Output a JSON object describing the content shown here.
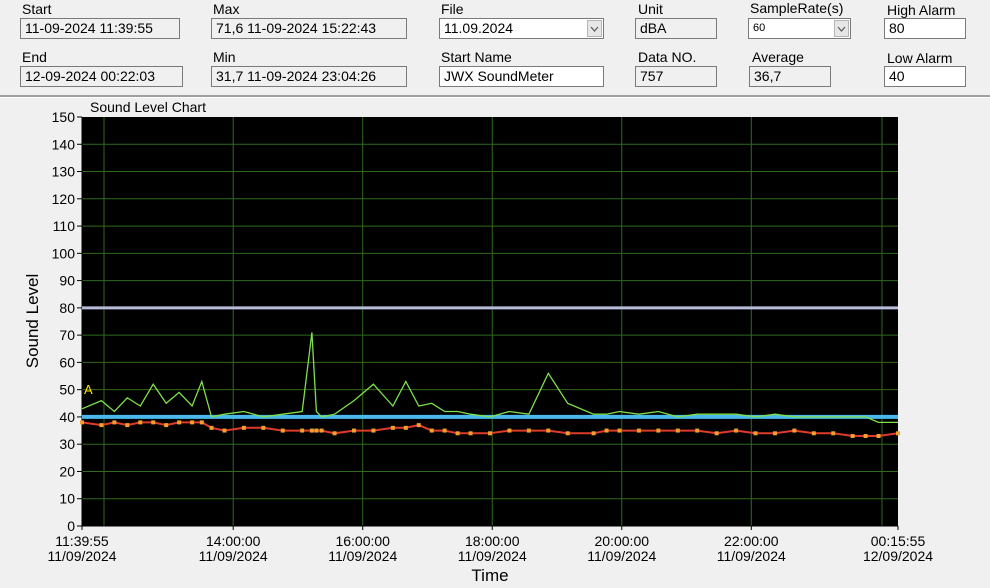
{
  "fields": {
    "start": {
      "label": "Start",
      "value": "11-09-2024 11:39:55"
    },
    "end": {
      "label": "End",
      "value": "12-09-2024 00:22:03"
    },
    "max": {
      "label": "Max",
      "value": "71,6 11-09-2024 15:22:43"
    },
    "min": {
      "label": "Min",
      "value": "31,7 11-09-2024 23:04:26"
    },
    "file": {
      "label": "File",
      "value": "11.09.2024"
    },
    "start_name": {
      "label": "Start Name",
      "value": "JWX SoundMeter"
    },
    "unit": {
      "label": "Unit",
      "value": "dBA"
    },
    "data_no": {
      "label": "Data NO.",
      "value": "757"
    },
    "sample_rate": {
      "label": "SampleRate(s)",
      "value": "60"
    },
    "average": {
      "label": "Average",
      "value": "36,7"
    },
    "high_alarm": {
      "label": "High Alarm",
      "value": "80"
    },
    "low_alarm": {
      "label": "Low Alarm",
      "value": "40"
    }
  },
  "colors": {
    "plot_bg": "#000000",
    "grid": "#2f6a1f",
    "high_alarm_line": "#b8bcd8",
    "low_alarm_line": "#4ab8ea",
    "max_trace": "#7fe04a",
    "min_trace": "#e03a2a",
    "marker": "#f0a030",
    "marker_label": "#ffe000"
  },
  "chart_data": {
    "type": "line",
    "title": "Sound Level Chart",
    "xlabel": "Time",
    "ylabel": "Sound Level",
    "ylim": [
      0,
      150
    ],
    "yticks": [
      0,
      10,
      20,
      30,
      40,
      50,
      60,
      70,
      80,
      90,
      100,
      110,
      120,
      130,
      140,
      150
    ],
    "xlim": [
      "11-09-2024 11:39:55",
      "12-09-2024 00:15:55"
    ],
    "xticks": [
      {
        "time": "11:39:55",
        "date": "11/09/2024"
      },
      {
        "time": "14:00:00",
        "date": "11/09/2024"
      },
      {
        "time": "16:00:00",
        "date": "11/09/2024"
      },
      {
        "time": "18:00:00",
        "date": "11/09/2024"
      },
      {
        "time": "20:00:00",
        "date": "11/09/2024"
      },
      {
        "time": "22:00:00",
        "date": "11/09/2024"
      },
      {
        "time": "00:15:55",
        "date": "12/09/2024"
      }
    ],
    "grid": true,
    "high_alarm": 80,
    "low_alarm": 40,
    "marker_label": "A",
    "series": [
      {
        "hours_since_start": [
          0,
          0.3,
          0.5,
          0.7,
          0.9,
          1.1,
          1.3,
          1.5,
          1.7,
          1.85,
          2.0,
          2.2,
          2.5,
          2.8,
          3.1,
          3.4,
          3.55,
          3.62,
          3.7,
          3.9,
          4.2,
          4.5,
          4.8,
          5.0,
          5.2,
          5.4,
          5.6,
          5.8,
          6.0,
          6.3,
          6.6,
          6.9,
          7.2,
          7.5,
          7.9,
          8.1,
          8.3,
          8.6,
          8.9,
          9.2,
          9.5,
          9.8,
          10.1,
          10.4,
          10.7,
          11.0,
          11.3,
          11.6,
          11.9,
          12.1,
          12.3,
          12.6
        ],
        "values": [
          43,
          46,
          42,
          47,
          44,
          52,
          45,
          49,
          44,
          53,
          40,
          41,
          42,
          40,
          41,
          42,
          71,
          42,
          40,
          41,
          46,
          52,
          44,
          53,
          44,
          45,
          42,
          42,
          41,
          40,
          42,
          41,
          56,
          45,
          41,
          41,
          42,
          41,
          42,
          40,
          41,
          41,
          41,
          40,
          41,
          40,
          40,
          40,
          40,
          40,
          38,
          38
        ]
      },
      {
        "hours_since_start": [
          0,
          0.3,
          0.5,
          0.7,
          0.9,
          1.1,
          1.3,
          1.5,
          1.7,
          1.85,
          2.0,
          2.2,
          2.5,
          2.8,
          3.1,
          3.4,
          3.55,
          3.62,
          3.7,
          3.9,
          4.2,
          4.5,
          4.8,
          5.0,
          5.2,
          5.4,
          5.6,
          5.8,
          6.0,
          6.3,
          6.6,
          6.9,
          7.2,
          7.5,
          7.9,
          8.1,
          8.3,
          8.6,
          8.9,
          9.2,
          9.5,
          9.8,
          10.1,
          10.4,
          10.7,
          11.0,
          11.3,
          11.6,
          11.9,
          12.1,
          12.3,
          12.6
        ],
        "values": [
          38,
          37,
          38,
          37,
          38,
          38,
          37,
          38,
          38,
          38,
          36,
          35,
          36,
          36,
          35,
          35,
          35,
          35,
          35,
          34,
          35,
          35,
          36,
          36,
          37,
          35,
          35,
          34,
          34,
          34,
          35,
          35,
          35,
          34,
          34,
          35,
          35,
          35,
          35,
          35,
          35,
          34,
          35,
          34,
          34,
          35,
          34,
          34,
          33,
          33,
          33,
          34
        ]
      }
    ]
  }
}
